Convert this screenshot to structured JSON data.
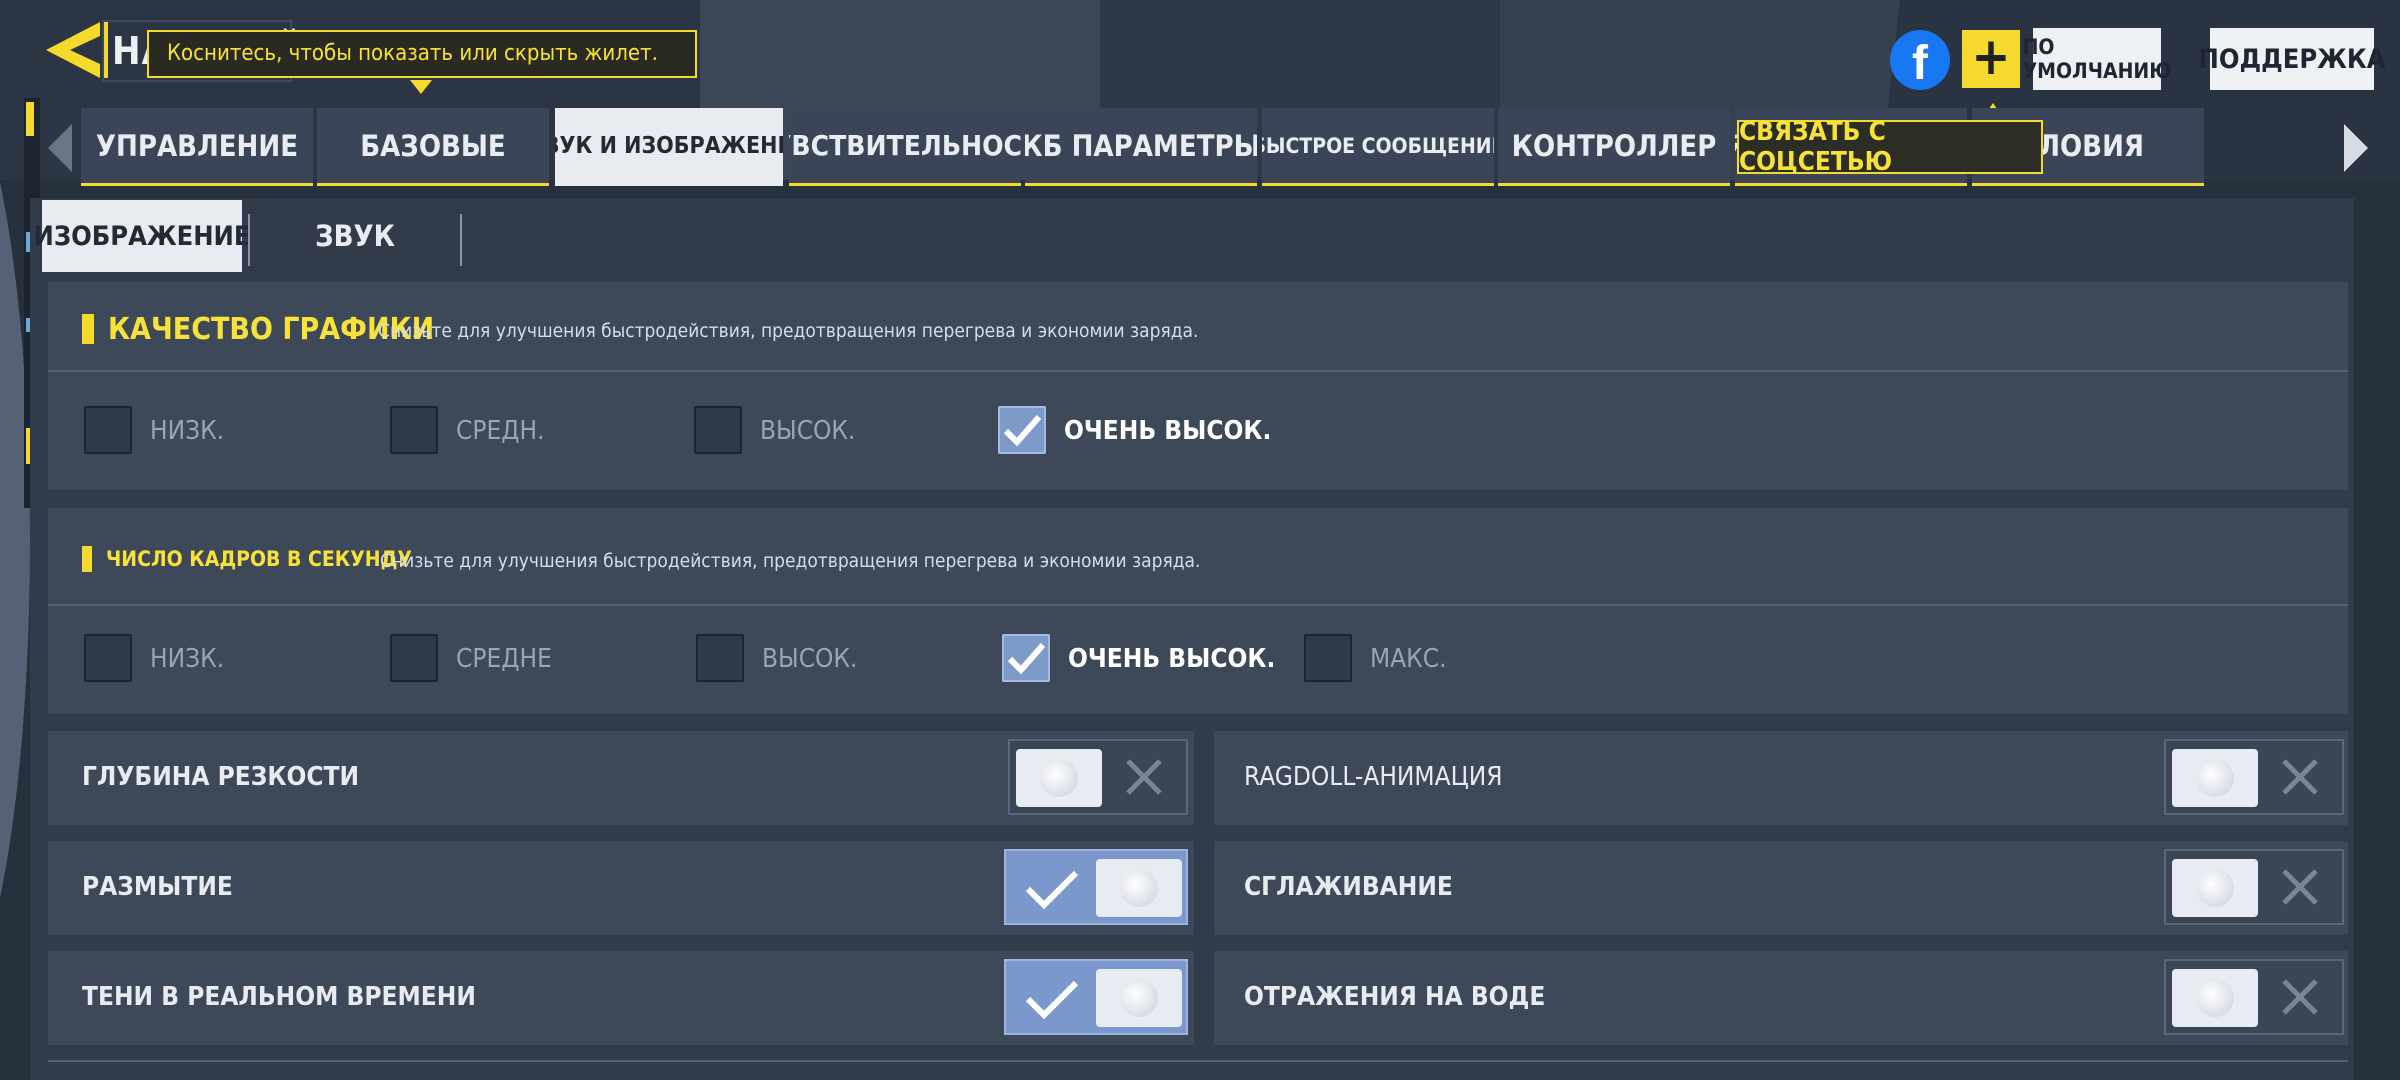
{
  "header": {
    "title": "НАСТРОЙКИ",
    "tooltip": "Коснитесь, чтобы показать или скрыть жилет.",
    "facebook_glyph": "f",
    "plus_glyph": "+",
    "default_button": "ПО УМОЛЧАНИЮ",
    "support_button": "ПОДДЕРЖКА"
  },
  "tabs": [
    {
      "label": "УПРАВЛЕНИЕ"
    },
    {
      "label": "БАЗОВЫЕ"
    },
    {
      "label": "ЗВУК И ИЗОБРАЖЕНИЕ",
      "active": true
    },
    {
      "label": "ЧУВСТВИТЕЛЬНОСТЬ"
    },
    {
      "label": "КБ ПАРАМЕТРЫ"
    },
    {
      "label": "БЫСТРОЕ СООБЩЕНИЕ"
    },
    {
      "label": "КОНТРОЛЛЕР"
    },
    {
      "label": "СВЯЗАТЬ С СОЦСЕТЬЮ"
    },
    {
      "label": "УСЛОВИЯ"
    }
  ],
  "tab_tooltip": "СВЯЗАТЬ С СОЦСЕТЬЮ",
  "subtabs": {
    "image": "ИЗОБРАЖЕНИЕ",
    "sound": "ЗВУК"
  },
  "graphics_quality": {
    "title": "КАЧЕСТВО ГРАФИКИ",
    "description": "Снизьте для улучшения быстродействия, предотвращения перегрева и экономии заряда.",
    "options": [
      {
        "label": "НИЗК.",
        "checked": false
      },
      {
        "label": "СРЕДН.",
        "checked": false
      },
      {
        "label": "ВЫСОК.",
        "checked": false
      },
      {
        "label": "ОЧЕНЬ ВЫСОК.",
        "checked": true
      }
    ]
  },
  "frame_rate": {
    "title": "ЧИСЛО КАДРОВ В СЕКУНДУ",
    "description": "Снизьте для улучшения быстродействия, предотвращения перегрева и экономии заряда.",
    "options": [
      {
        "label": "НИЗК.",
        "checked": false
      },
      {
        "label": "СРЕДНЕ",
        "checked": false
      },
      {
        "label": "ВЫСОК.",
        "checked": false
      },
      {
        "label": "ОЧЕНЬ ВЫСОК.",
        "checked": true
      },
      {
        "label": "МАКС.",
        "checked": false
      }
    ]
  },
  "toggles": [
    {
      "label": "ГЛУБИНА РЕЗКОСТИ",
      "on": false
    },
    {
      "label": "RAGDOLL-АНИМАЦИЯ",
      "on": false
    },
    {
      "label": "РАЗМЫТИЕ",
      "on": true
    },
    {
      "label": "СГЛАЖИВАНИЕ",
      "on": false
    },
    {
      "label": "ТЕНИ В РЕАЛЬНОМ ВРЕМЕНИ",
      "on": true
    },
    {
      "label": "ОТРАЖЕНИЯ НА ВОДЕ",
      "on": false
    }
  ],
  "colors": {
    "accent": "#f5d92c",
    "panel": "#323b4a",
    "toggle_on": "#7a98cc"
  }
}
